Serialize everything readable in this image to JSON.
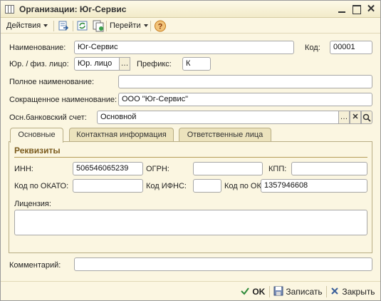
{
  "window": {
    "title": "Организации: Юг-Сервис"
  },
  "toolbar": {
    "actions_label": "Действия",
    "goto_label": "Перейти",
    "icons": [
      "move-to-group-icon",
      "refresh-icon",
      "copy-icon",
      "help-icon"
    ]
  },
  "form": {
    "name_label": "Наименование:",
    "name_value": "Юг-Сервис",
    "code_label": "Код:",
    "code_value": "00001",
    "legal_label": "Юр. / физ. лицо:",
    "legal_value": "Юр. лицо",
    "prefix_label": "Префикс:",
    "prefix_value": "К",
    "full_name_label": "Полное наименование:",
    "full_name_value": "",
    "short_name_label": "Сокращенное наименование:",
    "short_name_value": "ООО \"Юг-Сервис\"",
    "bank_label": "Осн.банковский счет:",
    "bank_value": "Основной"
  },
  "tabs": [
    {
      "label": "Основные",
      "active": true
    },
    {
      "label": "Контактная информация",
      "active": false
    },
    {
      "label": "Ответственные лица",
      "active": false
    }
  ],
  "requisites": {
    "group_title": "Реквизиты",
    "inn_label": "ИНН:",
    "inn_value": "506546065239",
    "ogrn_label": "ОГРН:",
    "ogrn_value": "",
    "kpp_label": "КПП:",
    "kpp_value": "",
    "okato_label": "Код по ОКАТО:",
    "okato_value": "",
    "ifns_label": "Код ИФНС:",
    "ifns_value": "",
    "okpo_label": "Код по ОКПО:",
    "okpo_value": "1357946608",
    "license_label": "Лицензия:",
    "license_value": ""
  },
  "comment": {
    "label": "Комментарий:",
    "value": ""
  },
  "buttons": {
    "ok": "OK",
    "save": "Записать",
    "close": "Закрыть"
  },
  "colors": {
    "window_bg": "#fbf6e1",
    "group_title": "#7a5a1c",
    "help_icon": "#e8a33a"
  }
}
